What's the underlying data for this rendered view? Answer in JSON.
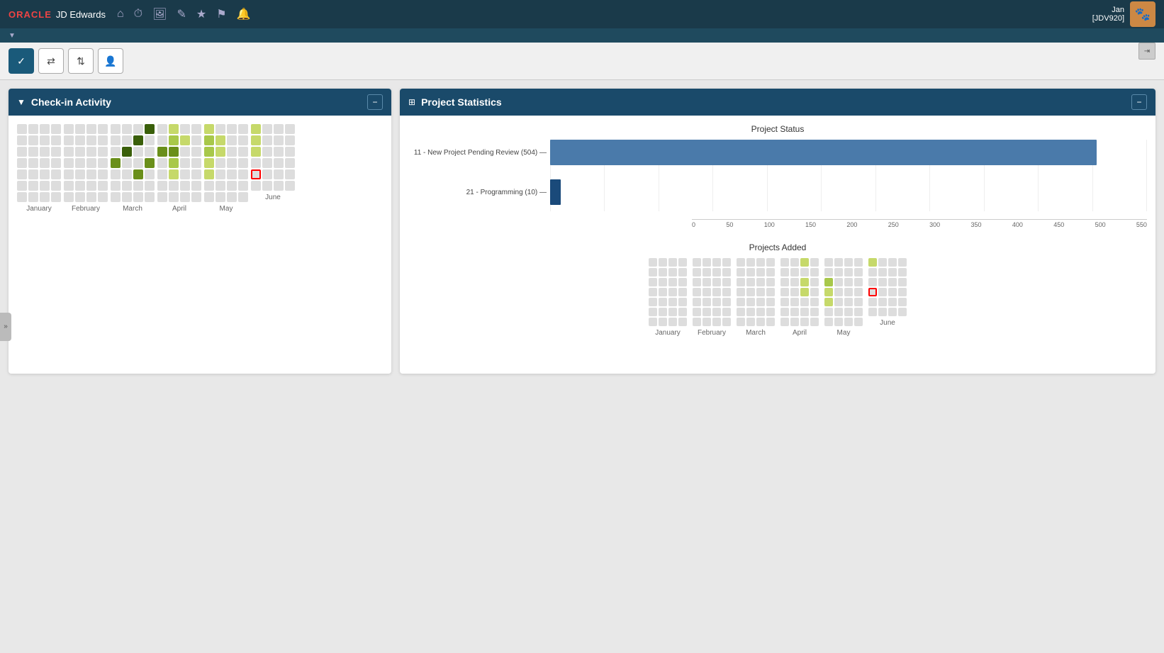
{
  "app": {
    "name": "JD Edwards",
    "oracle_text": "ORACLE",
    "user": "Jan",
    "user_id": "[JDV920]"
  },
  "toolbar": {
    "buttons": [
      "✓",
      "⇄",
      "⇅",
      "👤"
    ]
  },
  "checkin_panel": {
    "title": "Check-in Activity",
    "months": [
      "January",
      "February",
      "March",
      "April",
      "May",
      "June"
    ],
    "legend": [
      "l1",
      "l2",
      "l3",
      "l4",
      "l4"
    ]
  },
  "stats_panel": {
    "title": "Project Statistics",
    "bar_chart": {
      "title": "Project Status",
      "bars": [
        {
          "label": "11 - New Project Pending Review (504)",
          "value": 504,
          "max": 550,
          "color": "blue"
        },
        {
          "label": "21 - Programming (10)",
          "value": 10,
          "max": 550,
          "color": "dark-blue"
        }
      ],
      "x_ticks": [
        "0",
        "50",
        "100",
        "150",
        "200",
        "250",
        "300",
        "350",
        "400",
        "450",
        "500",
        "550"
      ]
    },
    "projects_added": {
      "title": "Projects Added",
      "months": [
        "January",
        "February",
        "March",
        "April",
        "May",
        "June"
      ],
      "legend": [
        "g1",
        "g2"
      ]
    }
  },
  "nav_icons": [
    "⌂",
    "⏱",
    "🖼",
    "✎",
    "★",
    "⚑",
    "🔔"
  ],
  "collapse_icon": "≡",
  "side_expand": "»"
}
